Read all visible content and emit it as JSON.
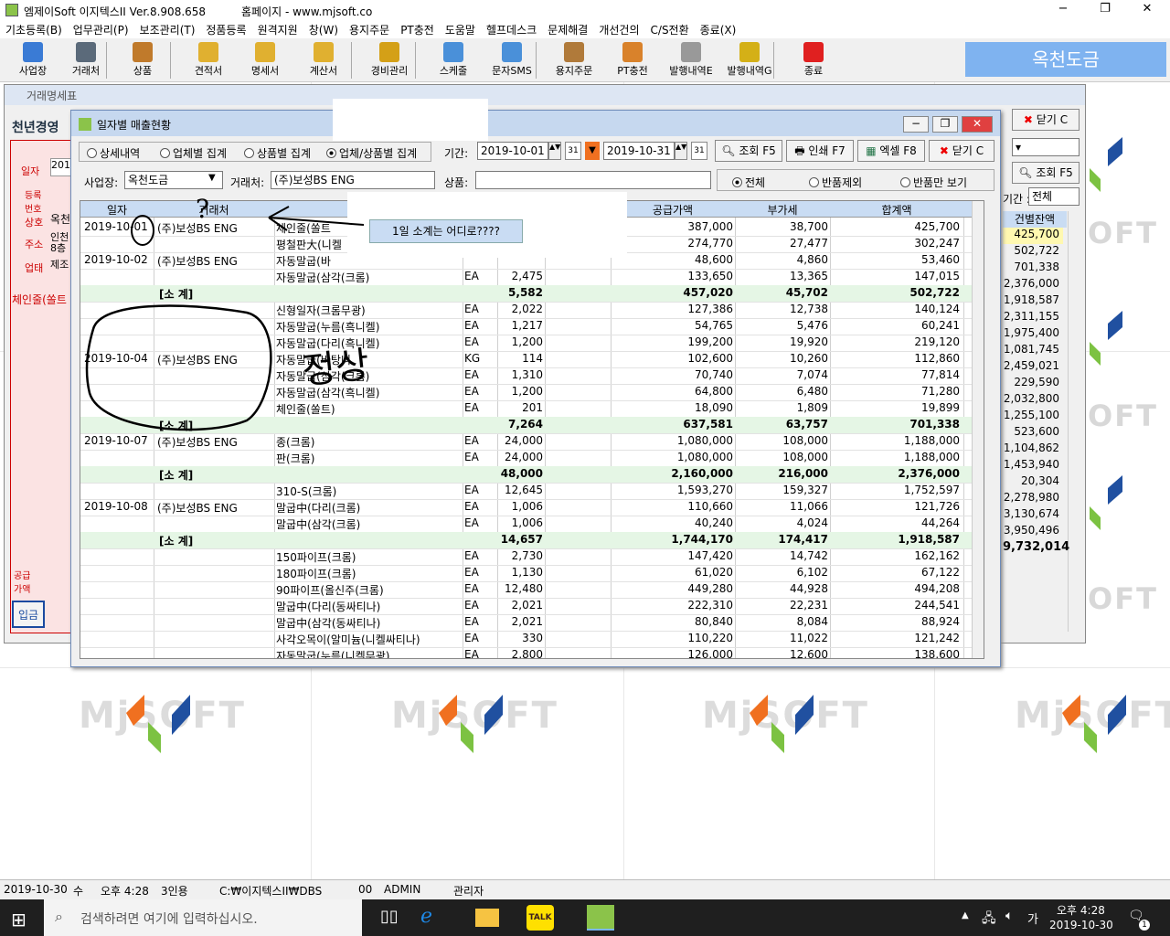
{
  "app": {
    "title": "엠제이Soft 이지텍스II Ver.8.908.658",
    "homepage": "홈페이지 - www.mjsoft.co",
    "brand_label": "옥천도금",
    "min": "−",
    "max": "❐",
    "close": "✕"
  },
  "menu": [
    "기초등록(B)",
    "업무관리(P)",
    "보조관리(T)",
    "정품등록",
    "원격지원",
    "창(W)",
    "용지주문",
    "PT충전",
    "도움말",
    "헬프데스크",
    "문제해결",
    "개선건의",
    "C/S전환",
    "종료(X)"
  ],
  "toolbar": [
    {
      "label": "사업장",
      "icon": "person-icon",
      "color": "#3a7bd5"
    },
    {
      "label": "거래처",
      "icon": "building-icon",
      "color": "#5b6a7a"
    },
    {
      "label": "상품",
      "icon": "box-icon",
      "color": "#c07a2b"
    },
    {
      "label": "견적서",
      "icon": "document-pen-icon",
      "color": "#e0b030"
    },
    {
      "label": "명세서",
      "icon": "document-pen-icon",
      "color": "#e0b030"
    },
    {
      "label": "계산서",
      "icon": "document-pen-icon",
      "color": "#e0b030"
    },
    {
      "label": "경비관리",
      "icon": "coins-icon",
      "color": "#d4a017"
    },
    {
      "label": "스케줄",
      "icon": "calendar-icon",
      "color": "#4a90d9"
    },
    {
      "label": "문자SMS",
      "icon": "phone-icon",
      "color": "#4a90d9"
    },
    {
      "label": "용지주문",
      "icon": "paper-box-icon",
      "color": "#b07a3a"
    },
    {
      "label": "PT충전",
      "icon": "coin-icon",
      "color": "#d9822b"
    },
    {
      "label": "발행내역E",
      "icon": "envelope-icon",
      "color": "#999999"
    },
    {
      "label": "발행내역G",
      "icon": "flower-icon",
      "color": "#d4b017"
    },
    {
      "label": "종료",
      "icon": "red-x-icon",
      "color": "#e02020"
    }
  ],
  "back_window": {
    "title": "거래명세표",
    "header_label": "천년경영",
    "labels": [
      "일자",
      "등록번호",
      "상호",
      "주소",
      "업태",
      "공급가액"
    ],
    "values": {
      "date": "201",
      "name": "옥천",
      "addr1": "인천",
      "addr2": "8층",
      "biz": "제조"
    },
    "product_line": "체인줄(쏠트",
    "close_label": "닫기 C",
    "search_label": "조회 F5",
    "period_label": "기간 :",
    "period_value": "전체",
    "balance_header": "건별잔액",
    "deposit_label": "입금",
    "balances": [
      "425,700",
      "502,722",
      "701,338",
      "2,376,000",
      "1,918,587",
      "2,311,155",
      "1,975,400",
      "1,081,745",
      "2,459,021",
      "229,590",
      "2,032,800",
      "1,255,100",
      "523,600",
      "1,104,862",
      "1,453,940",
      "20,304",
      "2,278,980",
      "3,130,674",
      "3,950,496",
      "9,732,014"
    ],
    "watermark_right": "OFT"
  },
  "front_window": {
    "title": "일자별 매출현황",
    "view_options": [
      "상세내역",
      "업체별 집계",
      "상품별 집계",
      "업체/상품별 집계"
    ],
    "selected_view": 3,
    "period_label": "기간:",
    "date_from": "2019-10-01",
    "date_to": "2019-10-31",
    "buttons": {
      "search": "조회 F5",
      "print": "인쇄 F7",
      "excel": "엑셀 F8",
      "close": "닫기 C"
    },
    "site_label": "사업장:",
    "site_value": "옥천도금",
    "client_label": "거래처:",
    "client_value": "(주)보성BS ENG",
    "product_label": "상품:",
    "product_value": "",
    "filter_options": [
      "전체",
      "반품제외",
      "반품만 보기"
    ],
    "selected_filter": 0,
    "columns": [
      "일자",
      "거래처",
      "",
      "",
      "",
      "",
      "공급가액",
      "부가세",
      "합계액"
    ],
    "rows": [
      {
        "t": "d",
        "date": "2019-10-01",
        "client": "(주)보성BS ENG",
        "item": "체인줄(쏠트",
        "unit": "",
        "qty": "",
        "supply": "387,000",
        "vat": "38,700",
        "total": "425,700"
      },
      {
        "t": "d",
        "date": "",
        "client": "",
        "item": "평철판大(니켈",
        "unit": "",
        "qty": "",
        "supply": "274,770",
        "vat": "27,477",
        "total": "302,247"
      },
      {
        "t": "d",
        "date": "2019-10-02",
        "client": "(주)보성BS ENG",
        "item": "자동말굽(바",
        "unit": "",
        "qty": "",
        "supply": "48,600",
        "vat": "4,860",
        "total": "53,460"
      },
      {
        "t": "d",
        "date": "",
        "client": "",
        "item": "자동말굽(삼각(크롬)",
        "unit": "EA",
        "qty": "2,475",
        "supply": "133,650",
        "vat": "13,365",
        "total": "147,015"
      },
      {
        "t": "s",
        "label": "[소 계]",
        "qty": "5,582",
        "supply": "457,020",
        "vat": "45,702",
        "total": "502,722"
      },
      {
        "t": "d",
        "date": "",
        "client": "",
        "item": "신형일자(크롬무광)",
        "unit": "EA",
        "qty": "2,022",
        "supply": "127,386",
        "vat": "12,738",
        "total": "140,124"
      },
      {
        "t": "d",
        "date": "",
        "client": "",
        "item": "자동말굽(누름(흑니켈)",
        "unit": "EA",
        "qty": "1,217",
        "supply": "54,765",
        "vat": "5,476",
        "total": "60,241"
      },
      {
        "t": "d",
        "date": "",
        "client": "",
        "item": "자동말굽(다리(흑니켈)",
        "unit": "EA",
        "qty": "1,200",
        "supply": "199,200",
        "vat": "19,920",
        "total": "219,120"
      },
      {
        "t": "d",
        "date": "2019-10-04",
        "client": "(주)보성BS ENG",
        "item": "자동말굽(바탕니",
        "unit": "KG",
        "qty": "114",
        "supply": "102,600",
        "vat": "10,260",
        "total": "112,860"
      },
      {
        "t": "d",
        "date": "",
        "client": "",
        "item": "자동말굽(삼각(크롬)",
        "unit": "EA",
        "qty": "1,310",
        "supply": "70,740",
        "vat": "7,074",
        "total": "77,814"
      },
      {
        "t": "d",
        "date": "",
        "client": "",
        "item": "자동말굽(삼각(흑니켈)",
        "unit": "EA",
        "qty": "1,200",
        "supply": "64,800",
        "vat": "6,480",
        "total": "71,280"
      },
      {
        "t": "d",
        "date": "",
        "client": "",
        "item": "체인줄(쏠트)",
        "unit": "EA",
        "qty": "201",
        "supply": "18,090",
        "vat": "1,809",
        "total": "19,899"
      },
      {
        "t": "s",
        "label": "[소 계]",
        "qty": "7,264",
        "supply": "637,581",
        "vat": "63,757",
        "total": "701,338"
      },
      {
        "t": "d",
        "date": "2019-10-07",
        "client": "(주)보성BS ENG",
        "item": "종(크롬)",
        "unit": "EA",
        "qty": "24,000",
        "supply": "1,080,000",
        "vat": "108,000",
        "total": "1,188,000"
      },
      {
        "t": "d",
        "date": "",
        "client": "",
        "item": "판(크롬)",
        "unit": "EA",
        "qty": "24,000",
        "supply": "1,080,000",
        "vat": "108,000",
        "total": "1,188,000"
      },
      {
        "t": "s",
        "label": "[소 계]",
        "qty": "48,000",
        "supply": "2,160,000",
        "vat": "216,000",
        "total": "2,376,000"
      },
      {
        "t": "d",
        "date": "",
        "client": "",
        "item": "310-S(크롬)",
        "unit": "EA",
        "qty": "12,645",
        "supply": "1,593,270",
        "vat": "159,327",
        "total": "1,752,597"
      },
      {
        "t": "d",
        "date": "2019-10-08",
        "client": "(주)보성BS ENG",
        "item": "말굽中(다리(크롬)",
        "unit": "EA",
        "qty": "1,006",
        "supply": "110,660",
        "vat": "11,066",
        "total": "121,726"
      },
      {
        "t": "d",
        "date": "",
        "client": "",
        "item": "말굽中(삼각(크롬)",
        "unit": "EA",
        "qty": "1,006",
        "supply": "40,240",
        "vat": "4,024",
        "total": "44,264"
      },
      {
        "t": "s",
        "label": "[소 계]",
        "qty": "14,657",
        "supply": "1,744,170",
        "vat": "174,417",
        "total": "1,918,587"
      },
      {
        "t": "d",
        "date": "",
        "client": "",
        "item": "150파이프(크롬)",
        "unit": "EA",
        "qty": "2,730",
        "supply": "147,420",
        "vat": "14,742",
        "total": "162,162"
      },
      {
        "t": "d",
        "date": "",
        "client": "",
        "item": "180파이프(크롬)",
        "unit": "EA",
        "qty": "1,130",
        "supply": "61,020",
        "vat": "6,102",
        "total": "67,122"
      },
      {
        "t": "d",
        "date": "",
        "client": "",
        "item": "90파이프(올신주(크롬)",
        "unit": "EA",
        "qty": "12,480",
        "supply": "449,280",
        "vat": "44,928",
        "total": "494,208"
      },
      {
        "t": "d",
        "date": "",
        "client": "",
        "item": "말굽中(다리(동싸티나)",
        "unit": "EA",
        "qty": "2,021",
        "supply": "222,310",
        "vat": "22,231",
        "total": "244,541"
      },
      {
        "t": "d",
        "date": "",
        "client": "",
        "item": "말굽中(삼각(동싸티나)",
        "unit": "EA",
        "qty": "2,021",
        "supply": "80,840",
        "vat": "8,084",
        "total": "88,924"
      },
      {
        "t": "d",
        "date": "",
        "client": "",
        "item": "사각오목이(알미늄(니켈싸티나)",
        "unit": "EA",
        "qty": "330",
        "supply": "110,220",
        "vat": "11,022",
        "total": "121,242"
      },
      {
        "t": "d",
        "date": "",
        "client": "",
        "item": "자동말굽(누름(니켈무광)",
        "unit": "EA",
        "qty": "2,800",
        "supply": "126,000",
        "vat": "12,600",
        "total": "138,600"
      }
    ]
  },
  "annotation": {
    "callout": "1일 소계는 어디로????",
    "mark_q": "?",
    "mark_ok": "정상",
    "mark_zero": "0",
    "arrow": "←"
  },
  "watermark": {
    "text": "MjSOFT",
    "colors": [
      "#f07020",
      "#2050a0"
    ]
  },
  "statusbar": [
    "2019-10-30",
    "수",
    "오후 4:28",
    "3인용",
    "C:₩이지텍스II₩DBS",
    "00",
    "ADMIN",
    "관리자"
  ],
  "taskbar": {
    "search_placeholder": "검색하려면 여기에 입력하십시오.",
    "clock_time": "오후 4:28",
    "clock_date": "2019-10-30",
    "ime": "가",
    "notif_count": "1",
    "kakao": "TALK"
  }
}
